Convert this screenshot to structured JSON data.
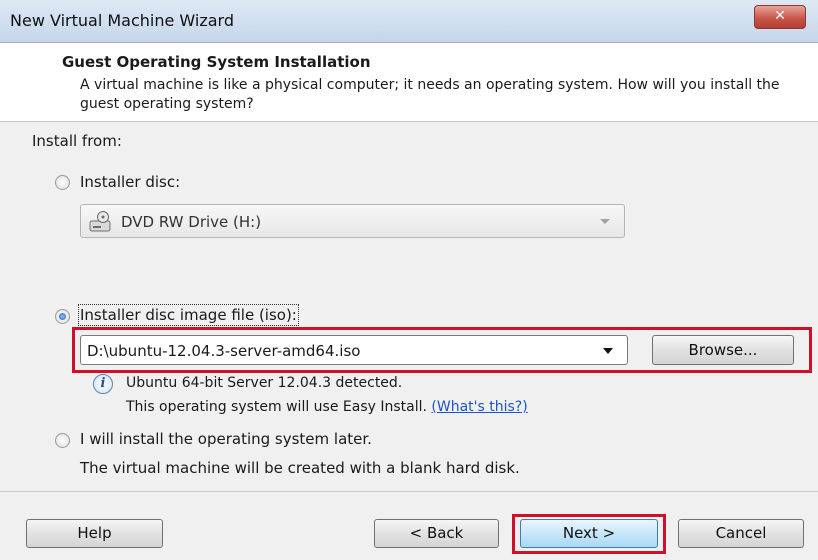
{
  "window": {
    "title": "New Virtual Machine Wizard",
    "close_glyph": "✕"
  },
  "header": {
    "title": "Guest Operating System Installation",
    "description": "A virtual machine is like a physical computer; it needs an operating system. How will you install the guest operating system?"
  },
  "install": {
    "section_label": "Install from:",
    "disc_option": {
      "label": "Installer disc:",
      "selected": false,
      "drive_value": "DVD RW Drive (H:)",
      "drive_icon": "dvd-drive-icon"
    },
    "iso_option": {
      "label": "Installer disc image file (iso):",
      "selected": true,
      "path_value": "D:\\ubuntu-12.04.3-server-amd64.iso",
      "browse_label": "Browse...",
      "detected_text": "Ubuntu 64-bit Server 12.04.3 detected.",
      "easy_install_text": "This operating system will use Easy Install.",
      "whats_this_link": "(What's this?)",
      "info_icon": "info-icon"
    },
    "later_option": {
      "label": "I will install the operating system later.",
      "selected": false,
      "note": "The virtual machine will be created with a blank hard disk."
    }
  },
  "footer": {
    "help_label": "Help",
    "back_label": "< Back",
    "next_label": "Next >",
    "cancel_label": "Cancel"
  },
  "colors": {
    "highlight_border": "#d0102a",
    "link": "#1a55c8",
    "dialog_background": "#f0f0f0"
  }
}
